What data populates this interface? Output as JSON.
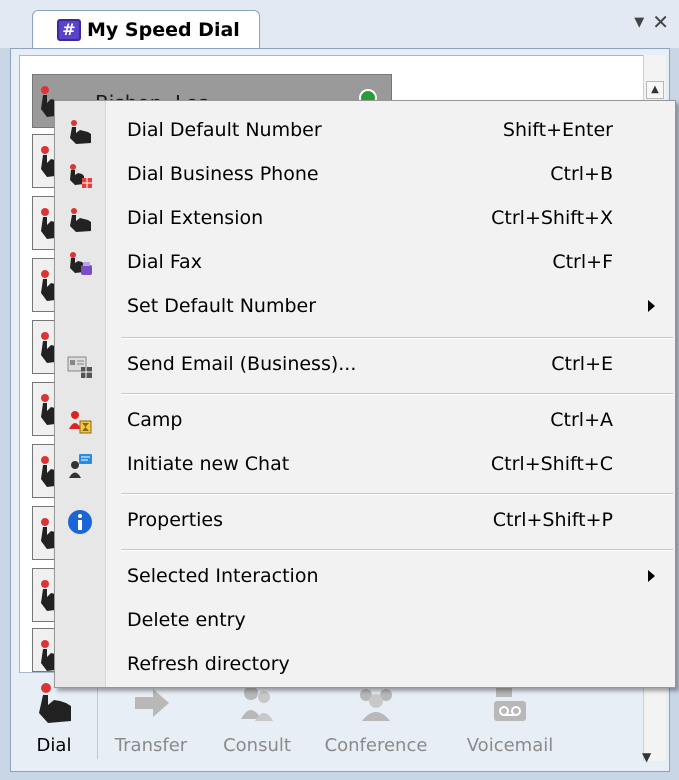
{
  "tab": {
    "icon": "speed-dial-icon",
    "title": "My Speed Dial"
  },
  "window_controls": {
    "dropdown": "▼",
    "close": "✕"
  },
  "selected_entry": {
    "name": "Bishop, Lea",
    "status_color": "#2b9c3b"
  },
  "menu": {
    "items": [
      {
        "label": "Dial Default Number",
        "shortcut": "Shift+Enter",
        "icon": "dial-hand-icon"
      },
      {
        "label": "Dial Business Phone",
        "shortcut": "Ctrl+B",
        "icon": "dial-business-icon"
      },
      {
        "label": "Dial Extension",
        "shortcut": "Ctrl+Shift+X",
        "icon": "dial-extension-icon"
      },
      {
        "label": "Dial Fax",
        "shortcut": "Ctrl+F",
        "icon": "dial-fax-icon"
      },
      {
        "label": "Set Default Number",
        "shortcut": "",
        "icon": "",
        "submenu": true
      },
      {
        "label": "Send Email (Business)...",
        "shortcut": "Ctrl+E",
        "icon": "email-card-icon"
      },
      {
        "label": "Camp",
        "shortcut": "Ctrl+A",
        "icon": "camp-icon"
      },
      {
        "label": "Initiate new Chat",
        "shortcut": "Ctrl+Shift+C",
        "icon": "chat-icon"
      },
      {
        "label": "Properties",
        "shortcut": "Ctrl+Shift+P",
        "icon": "info-icon"
      },
      {
        "label": "Selected Interaction",
        "shortcut": "",
        "icon": "",
        "submenu": true
      },
      {
        "label": "Delete entry",
        "shortcut": "",
        "icon": ""
      },
      {
        "label": "Refresh directory",
        "shortcut": "",
        "icon": ""
      }
    ]
  },
  "toolbar": {
    "dial": "Dial",
    "transfer": "Transfer",
    "consult": "Consult",
    "conference": "Conference",
    "voicemail": "Voicemail"
  }
}
